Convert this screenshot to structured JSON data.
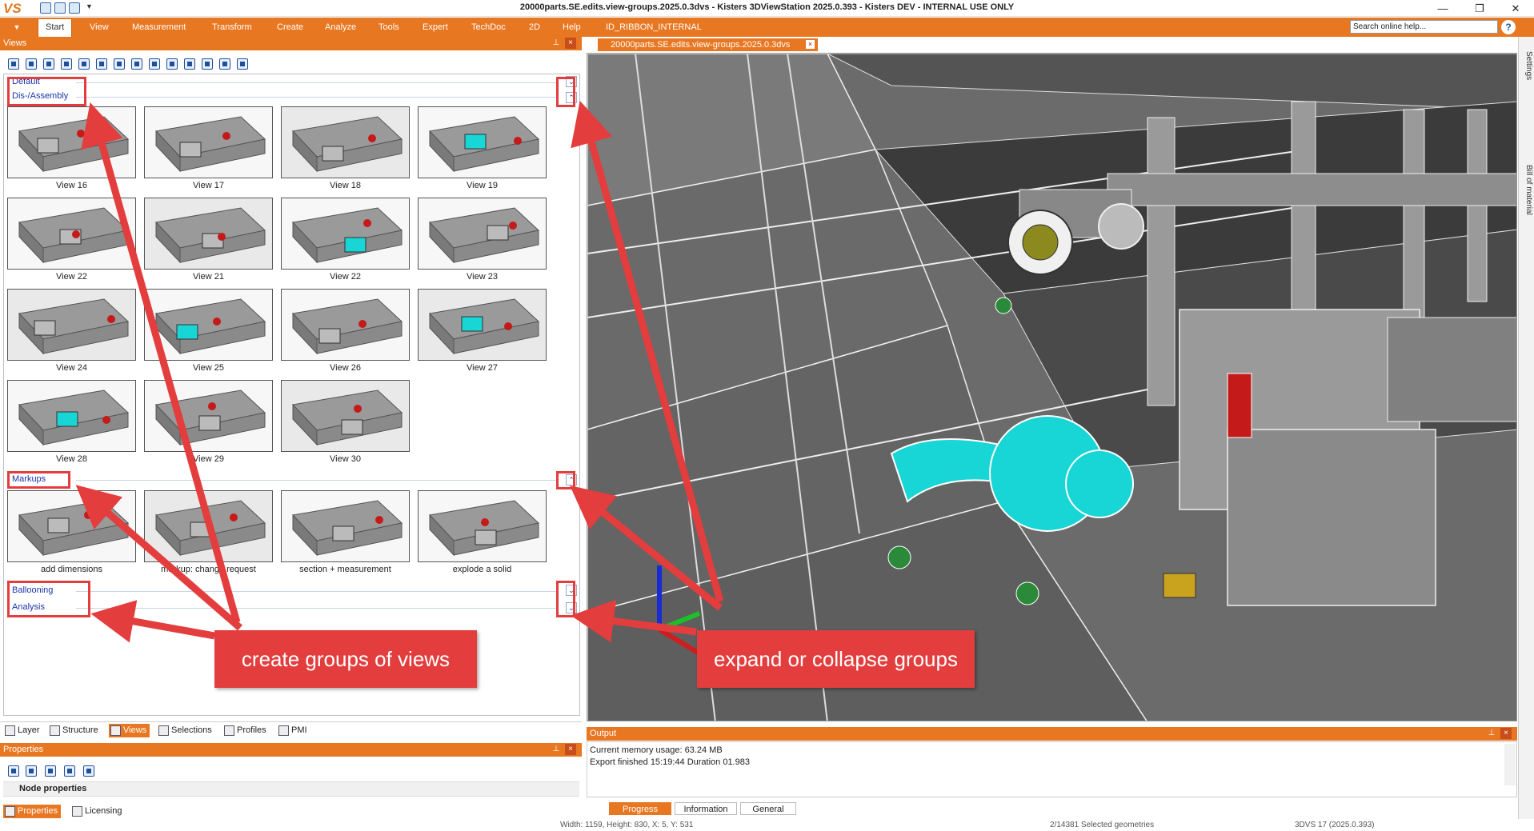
{
  "window": {
    "app_logo": "VS",
    "title": "20000parts.SE.edits.view-groups.2025.0.3dvs - Kisters 3DViewStation 2025.0.393 - Kisters DEV - INTERNAL USE ONLY",
    "min": "—",
    "restore": "❐",
    "close": "✕"
  },
  "ribbon": {
    "menu_label": "▼",
    "tabs": [
      "Start",
      "View",
      "Measurement",
      "Transform",
      "Create",
      "Analyze",
      "Tools",
      "Expert",
      "TechDoc",
      "2D",
      "Help",
      "ID_RIBBON_INTERNAL"
    ],
    "active_tab": "Start",
    "search_placeholder": "Search online help...",
    "help_icon": "?"
  },
  "views_pane": {
    "title": "Views",
    "pin": "⊥",
    "close": "×",
    "groups": [
      {
        "label": "Default",
        "state": "collapsed",
        "btn": "⌄"
      },
      {
        "label": "Dis-/Assembly",
        "state": "expanded",
        "btn": "⌃"
      },
      {
        "label": "Markups",
        "state": "expanded",
        "btn": "⌃"
      },
      {
        "label": "Ballooning",
        "state": "collapsed",
        "btn": "⌄"
      },
      {
        "label": "Analysis",
        "state": "collapsed",
        "btn": "⌄"
      }
    ],
    "assembly_views": [
      "View 16",
      "View 17",
      "View 18",
      "View 19",
      "View 22",
      "View 21",
      "View 22",
      "View 23",
      "View 24",
      "View 25",
      "View 26",
      "View 27",
      "View 28",
      "View 29",
      "View 30"
    ],
    "markup_views": [
      "add dimensions",
      "markup: change request",
      "section + measurement",
      "explode a solid"
    ]
  },
  "bottom_tabs": [
    {
      "label": "Layer",
      "active": false
    },
    {
      "label": "Structure",
      "active": false
    },
    {
      "label": "Views",
      "active": true
    },
    {
      "label": "Selections",
      "active": false
    },
    {
      "label": "Profiles",
      "active": false
    },
    {
      "label": "PMI",
      "active": false
    }
  ],
  "properties_pane": {
    "title": "Properties",
    "node_properties": "Node properties",
    "tabs": [
      {
        "label": "Properties",
        "active": true
      },
      {
        "label": "Licensing",
        "active": false
      }
    ]
  },
  "document_tab": {
    "label": "20000parts.SE.edits.view-groups.2025.0.3dvs"
  },
  "right_strip": {
    "settings": "Settings",
    "bom": "Bill of material"
  },
  "output_pane": {
    "title": "Output",
    "lines": [
      "Current memory usage: 63.24 MB",
      "Export finished 15:19:44 Duration 01.983"
    ],
    "tabs": [
      {
        "label": "Progress",
        "active": true
      },
      {
        "label": "Information",
        "active": false
      },
      {
        "label": "General",
        "active": false
      }
    ]
  },
  "status_bar": {
    "dimensions": "Width: 1159, Height: 830, X: 5, Y: 531",
    "selected": "2/14381 Selected geometries",
    "version": "3DVS 17 (2025.0.393)"
  },
  "annotations": {
    "left_callout": "create groups of views",
    "right_callout": "expand or collapse groups"
  },
  "colors": {
    "accent": "#e87722",
    "annotation": "#e33d3d",
    "highlight": "#19d6d6",
    "group_text": "#1a36a8"
  }
}
